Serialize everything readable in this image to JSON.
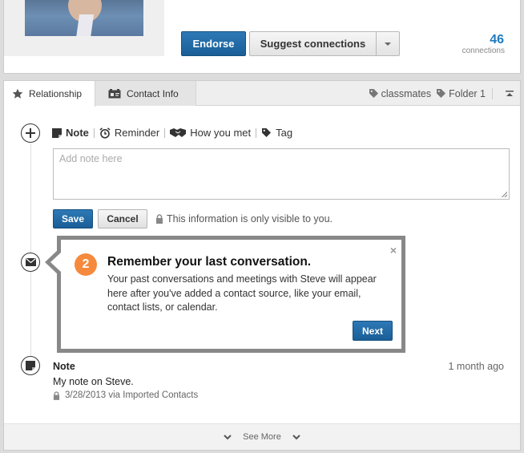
{
  "profile": {
    "endorse_label": "Endorse",
    "suggest_label": "Suggest connections",
    "connections_count": "46",
    "connections_label": "connections"
  },
  "tabs": [
    {
      "label": "Relationship",
      "icon": "star-icon",
      "active": true
    },
    {
      "label": "Contact Info",
      "icon": "contact-card-icon",
      "active": false
    }
  ],
  "tags": {
    "items": [
      "classmates",
      "Folder 1"
    ]
  },
  "note_toolbar": {
    "note": "Note",
    "reminder": "Reminder",
    "how_you_met": "How you met",
    "tag": "Tag"
  },
  "note_form": {
    "placeholder": "Add note here",
    "save_label": "Save",
    "cancel_label": "Cancel",
    "privacy_text": "This information is only visible to you."
  },
  "callout": {
    "step": "2",
    "title": "Remember your last conversation.",
    "body": "Your past conversations and meetings with Steve will appear here after you've added a contact source, like your email, contact lists, or calendar.",
    "close": "×",
    "next_label": "Next"
  },
  "note_entry": {
    "heading": "Note",
    "time": "1 month ago",
    "text": "My note on Steve.",
    "meta": "3/28/2013 via Imported Contacts"
  },
  "footer": {
    "see_more": "See More"
  },
  "colors": {
    "primary_button": "#1a5e97",
    "link_blue": "#1f7bc1",
    "step_badge": "#f58a3c",
    "callout_border": "#888888"
  }
}
